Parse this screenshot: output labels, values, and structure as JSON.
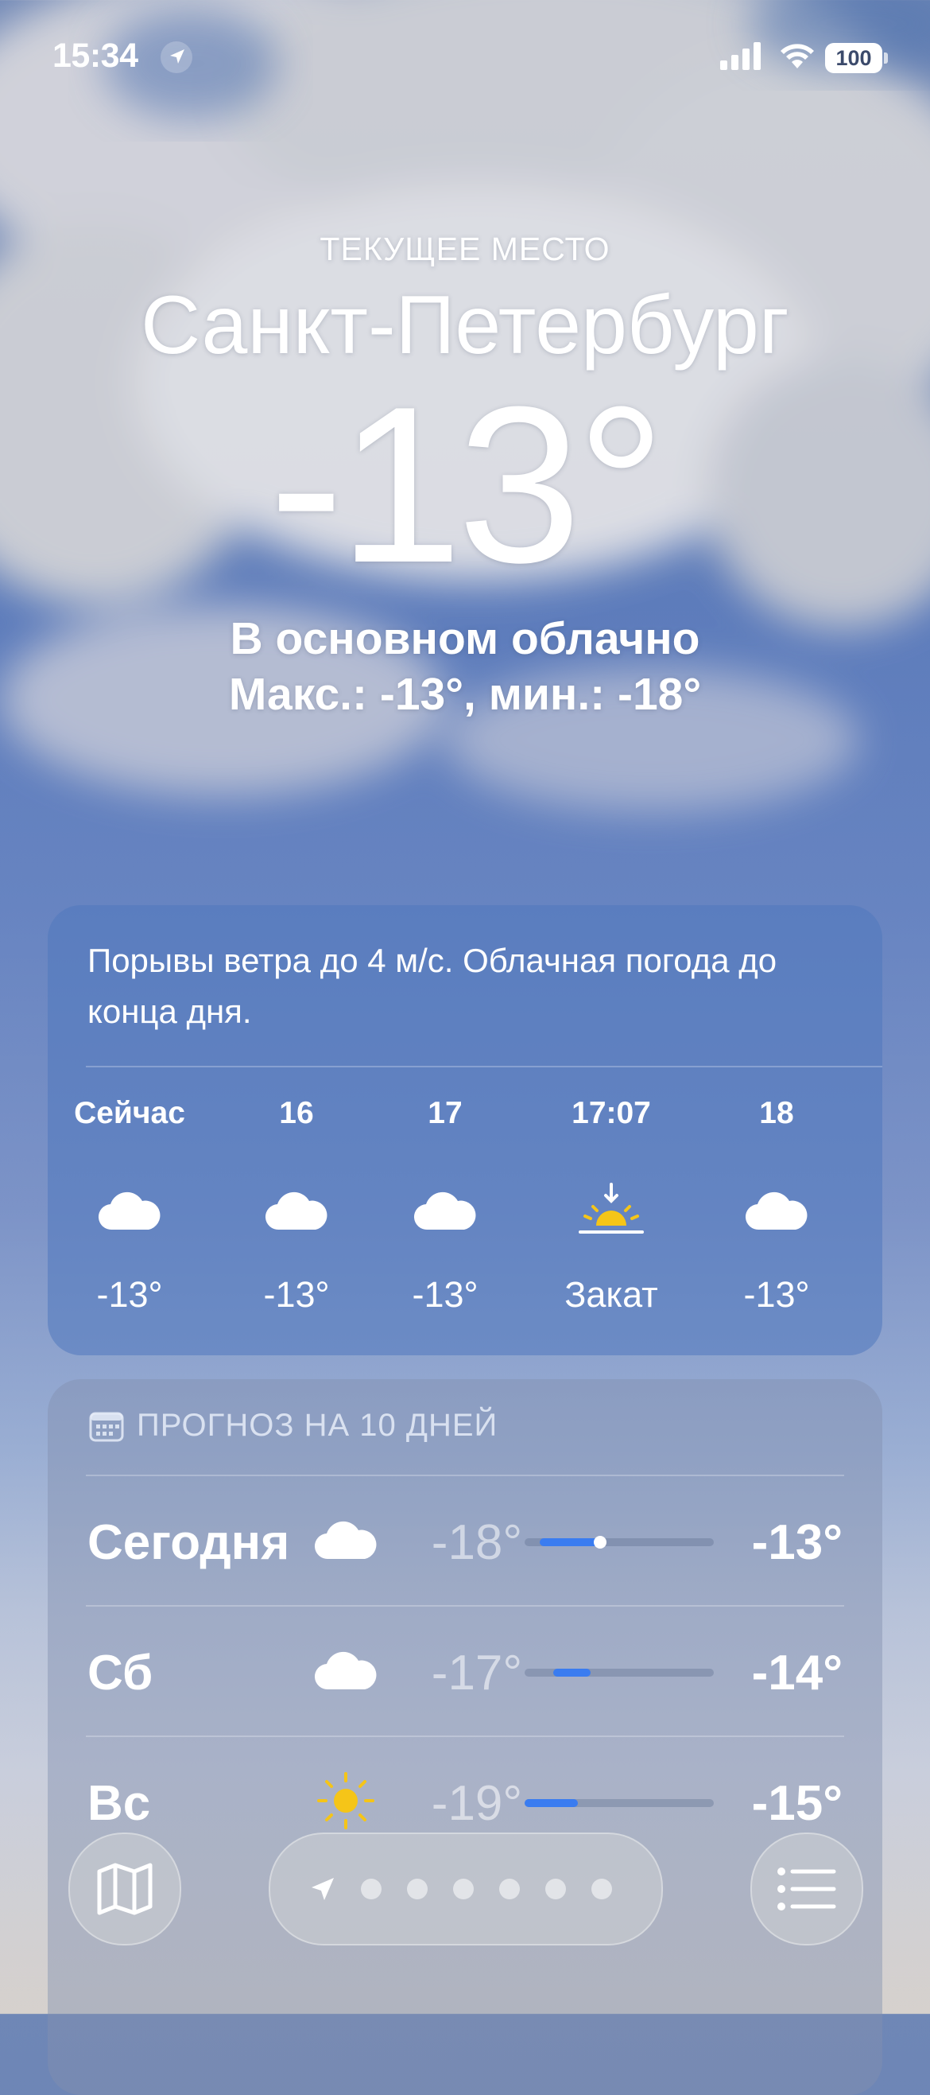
{
  "status_bar": {
    "time": "15:34",
    "battery": "100"
  },
  "hero": {
    "location_label": "ТЕКУЩЕЕ МЕСТО",
    "city": "Санкт-Петербург",
    "temperature": "-13°",
    "condition": "В основном облачно",
    "high_low": "Макс.: -13°, мин.: -18°"
  },
  "hourly": {
    "summary": "Порывы ветра до 4 м/с. Облачная погода до конца дня.",
    "items": [
      {
        "time": "Сейчас",
        "icon": "cloud-icon",
        "value": "-13°"
      },
      {
        "time": "16",
        "icon": "cloud-icon",
        "value": "-13°"
      },
      {
        "time": "17",
        "icon": "cloud-icon",
        "value": "-13°"
      },
      {
        "time": "17:07",
        "icon": "sunset-icon",
        "value": "Закат"
      },
      {
        "time": "18",
        "icon": "cloud-icon",
        "value": "-13°"
      }
    ]
  },
  "daily": {
    "header": "ПРОГНОЗ НА 10 ДНЕЙ",
    "days": [
      {
        "name": "Сегодня",
        "icon": "cloud-icon",
        "low": "-18°",
        "high": "-13°",
        "range_start": 0.08,
        "range_end": 0.4,
        "current": 0.4
      },
      {
        "name": "Сб",
        "icon": "cloud-icon",
        "low": "-17°",
        "high": "-14°",
        "range_start": 0.15,
        "range_end": 0.35
      },
      {
        "name": "Вс",
        "icon": "sun-icon",
        "low": "-19°",
        "high": "-15°",
        "range_start": 0.0,
        "range_end": 0.28
      }
    ]
  },
  "colors": {
    "bar_fill": "#3a7cf0",
    "sun": "#f5c518"
  }
}
